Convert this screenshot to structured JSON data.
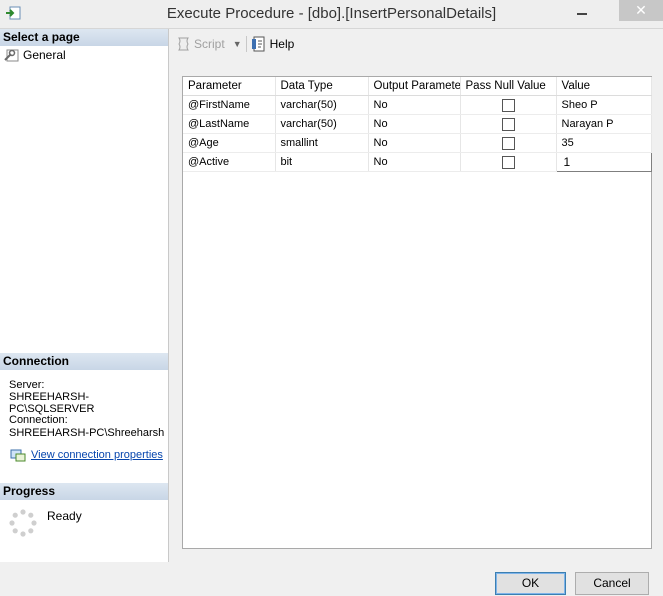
{
  "window": {
    "title": "Execute Procedure - [dbo].[InsertPersonalDetails]",
    "close_glyph": "✕"
  },
  "left_pane": {
    "select_page_header": "Select a page",
    "pages": [
      {
        "label": "General",
        "icon": "wrench-page-icon"
      }
    ],
    "connection_header": "Connection",
    "server_label": "Server:",
    "server_value": "SHREEHARSH-PC\\SQLSERVER",
    "connection_label": "Connection:",
    "connection_value": "SHREEHARSH-PC\\Shreeharsh",
    "view_connection_link": "View connection properties",
    "progress_header": "Progress",
    "progress_status": "Ready"
  },
  "toolbar": {
    "script_label": "Script",
    "help_label": "Help"
  },
  "grid": {
    "headers": [
      "Parameter",
      "Data Type",
      "Output Parameter",
      "Pass Null Value",
      "Value"
    ],
    "rows": [
      {
        "parameter": "@FirstName",
        "data_type": "varchar(50)",
        "output": "No",
        "pass_null": false,
        "value": "Sheo P"
      },
      {
        "parameter": "@LastName",
        "data_type": "varchar(50)",
        "output": "No",
        "pass_null": false,
        "value": "Narayan P"
      },
      {
        "parameter": "@Age",
        "data_type": "smallint",
        "output": "No",
        "pass_null": false,
        "value": "35"
      },
      {
        "parameter": "@Active",
        "data_type": "bit",
        "output": "No",
        "pass_null": false,
        "value": "1"
      }
    ]
  },
  "buttons": {
    "ok": "OK",
    "cancel": "Cancel"
  }
}
